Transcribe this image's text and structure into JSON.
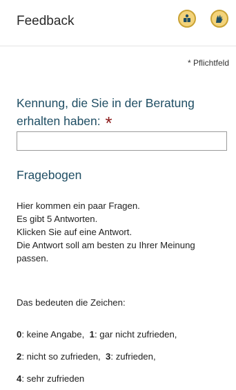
{
  "header": {
    "title": "Feedback",
    "easy_language_icon": "easy-language-icon",
    "sign_language_icon": "sign-language-icon",
    "icon_bg": "#f3d37a",
    "icon_border": "#c9a234"
  },
  "form": {
    "required_note": "* Pflichtfeld",
    "id_label": "Kennung, die Sie in der Beratung erhalten haben:",
    "required_star": "*",
    "id_value": ""
  },
  "questionnaire": {
    "title": "Fragebogen",
    "intro_lines": [
      "Hier kommen ein paar Fragen.",
      "Es gibt 5 Antworten.",
      "Klicken Sie auf eine Antwort.",
      "Die Antwort soll am besten zu Ihrer Meinung",
      "passen."
    ],
    "legend_intro": "Das bedeuten die Zeichen:",
    "legend": [
      {
        "num": "0",
        "text": ": keine Angabe, "
      },
      {
        "num": "1",
        "text": ": gar nicht zufrieden,"
      },
      {
        "num": "2",
        "text": ": nicht so zufrieden, "
      },
      {
        "num": "3",
        "text": ": zufrieden,"
      },
      {
        "num": "4",
        "text": ": sehr zufrieden"
      }
    ]
  },
  "colors": {
    "heading": "#1e4d63",
    "required_star": "#8b1a1a"
  }
}
